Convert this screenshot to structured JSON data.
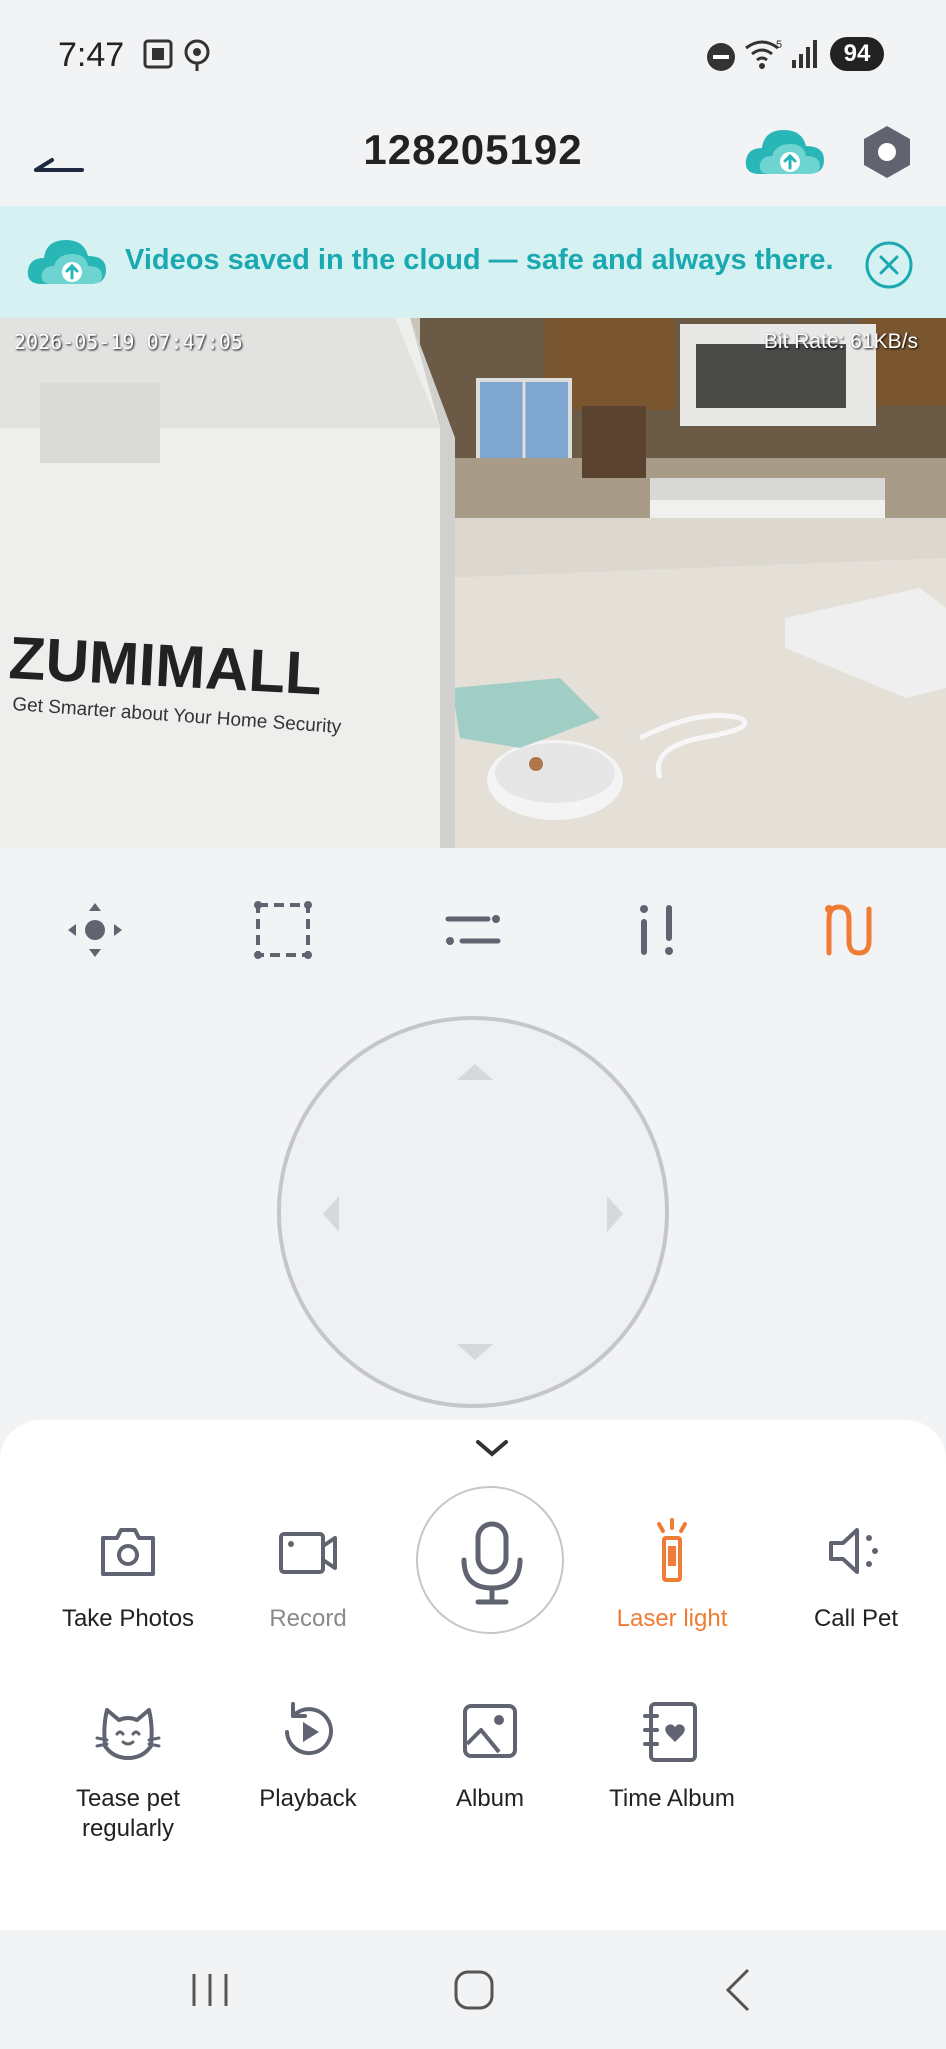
{
  "status_bar": {
    "time": "7:47",
    "battery": "94",
    "icons": [
      "screenshot-icon",
      "location-icon",
      "dnd-icon",
      "wifi-icon",
      "signal-icon",
      "battery-icon"
    ]
  },
  "header": {
    "title": "128205192",
    "back_icon": "back-arrow-icon",
    "cloud_icon": "cloud-upload-icon",
    "settings_icon": "hexagon-settings-icon"
  },
  "banner": {
    "text": "Videos saved in the cloud — safe and always there.",
    "accent": "#1aa9b0",
    "background": "#d6f1f1"
  },
  "video": {
    "timestamp": "2026-05-19 07:47:05",
    "bitrate": "Bit Rate: 61KB/s",
    "brand_on_box": "ZUMIMALL",
    "box_tagline": "Get Smarter about Your Home Security"
  },
  "tools": [
    {
      "name": "pan-tilt-icon",
      "active": false
    },
    {
      "name": "crop-frame-icon",
      "active": false
    },
    {
      "name": "sliders-icon",
      "active": false
    },
    {
      "name": "alert-icon",
      "active": false
    },
    {
      "name": "path-icon",
      "active": true
    }
  ],
  "actions_row1": [
    {
      "label": "Take Photos",
      "icon": "camera-icon",
      "state": "normal"
    },
    {
      "label": "Record",
      "icon": "video-record-icon",
      "state": "muted"
    },
    {
      "label": "",
      "icon": "microphone-icon",
      "state": "normal"
    },
    {
      "label": "Laser light",
      "icon": "laser-icon",
      "state": "active"
    },
    {
      "label": "Call Pet",
      "icon": "speaker-icon",
      "state": "normal"
    }
  ],
  "actions_row2": [
    {
      "label": "Tease pet regularly",
      "icon": "cat-icon"
    },
    {
      "label": "Playback",
      "icon": "playback-icon"
    },
    {
      "label": "Album",
      "icon": "image-album-icon"
    },
    {
      "label": "Time Album",
      "icon": "heart-book-icon"
    }
  ],
  "colors": {
    "accent_orange": "#f07c34",
    "teal": "#1aa9b0",
    "icon_gray": "#5f6470"
  }
}
